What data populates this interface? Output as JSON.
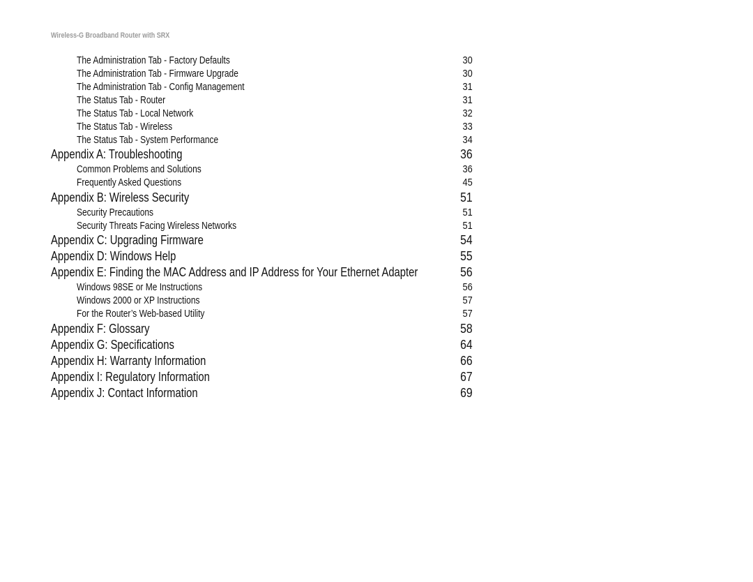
{
  "header": {
    "running_title": "Wireless-G Broadband Router with SRX"
  },
  "toc": {
    "entries": [
      {
        "level": "sub",
        "title": "The Administration Tab - Factory Defaults",
        "page": "30"
      },
      {
        "level": "sub",
        "title": "The Administration Tab - Firmware Upgrade",
        "page": "30"
      },
      {
        "level": "sub",
        "title": "The Administration Tab - Config Management",
        "page": "31"
      },
      {
        "level": "sub",
        "title": "The Status Tab - Router",
        "page": "31"
      },
      {
        "level": "sub",
        "title": "The Status Tab - Local Network",
        "page": "32"
      },
      {
        "level": "sub",
        "title": "The Status Tab - Wireless",
        "page": "33"
      },
      {
        "level": "sub",
        "title": "The Status Tab - System Performance",
        "page": "34"
      },
      {
        "level": "major",
        "title": "Appendix A: Troubleshooting",
        "page": "36"
      },
      {
        "level": "sub",
        "title": "Common Problems and Solutions",
        "page": "36"
      },
      {
        "level": "sub",
        "title": "Frequently Asked Questions",
        "page": "45"
      },
      {
        "level": "major",
        "title": "Appendix B: Wireless Security",
        "page": "51"
      },
      {
        "level": "sub",
        "title": "Security Precautions",
        "page": "51"
      },
      {
        "level": "sub",
        "title": "Security Threats Facing Wireless Networks",
        "page": "51"
      },
      {
        "level": "major",
        "title": "Appendix C: Upgrading Firmware",
        "page": "54"
      },
      {
        "level": "major",
        "title": "Appendix D: Windows Help",
        "page": "55"
      },
      {
        "level": "major",
        "title": "Appendix E: Finding the MAC Address and IP Address for Your Ethernet Adapter",
        "page": "56"
      },
      {
        "level": "sub",
        "title": "Windows 98SE or Me Instructions",
        "page": "56"
      },
      {
        "level": "sub",
        "title": "Windows 2000 or XP Instructions",
        "page": "57"
      },
      {
        "level": "sub",
        "title": "For the Router’s Web-based Utility",
        "page": "57"
      },
      {
        "level": "major",
        "title": "Appendix F: Glossary",
        "page": "58"
      },
      {
        "level": "major",
        "title": "Appendix G: Specifications",
        "page": "64"
      },
      {
        "level": "major",
        "title": "Appendix H: Warranty Information",
        "page": "66"
      },
      {
        "level": "major",
        "title": "Appendix I: Regulatory Information",
        "page": "67"
      },
      {
        "level": "major",
        "title": "Appendix J: Contact Information",
        "page": "69"
      }
    ]
  }
}
